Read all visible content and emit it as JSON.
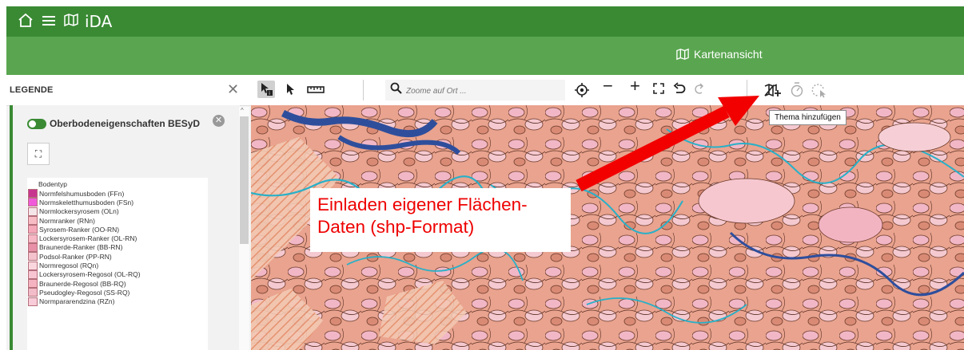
{
  "topbar": {
    "home_icon": "home-icon",
    "menu_icon": "menu-icon",
    "map_icon": "map-icon",
    "app_name": "iDA"
  },
  "subbar": {
    "view_label": "Kartenansicht"
  },
  "sidebar": {
    "title": "LEGENDE",
    "close": "✕",
    "layer_name": "Oberbodeneigenschaften BESyD",
    "legend_caption": "Bodentyp",
    "legend_items": [
      {
        "label": "Normfelshumusboden (FFn)",
        "color": "#c8358f"
      },
      {
        "label": "Normskeletthumusboden (FSn)",
        "color": "#f05ad8"
      },
      {
        "label": "Normlockersyrosem (OLn)",
        "color": "#f4e6e8"
      },
      {
        "label": "Normranker (RNn)",
        "color": "#f7bcc4"
      },
      {
        "label": "Syrosem-Ranker (OO-RN)",
        "color": "#f5a8b8"
      },
      {
        "label": "Lockersyrosem-Ranker (OL-RN)",
        "color": "#f7b8c6"
      },
      {
        "label": "Braunerde-Ranker (BB-RN)",
        "color": "#e890a8"
      },
      {
        "label": "Podsol-Ranker (PP-RN)",
        "color": "#f4c2cc"
      },
      {
        "label": "Normregosol (RQn)",
        "color": "#fad7de"
      },
      {
        "label": "Lockersyrosem-Regosol (OL-RQ)",
        "color": "#f7c4d2"
      },
      {
        "label": "Braunerde-Regosol (BB-RQ)",
        "color": "#f5b3c1"
      },
      {
        "label": "Pseudogley-Regosol (SS-RQ)",
        "color": "#f2bcc8"
      },
      {
        "label": "Normpararendzina (RZn)",
        "color": "#f8ccd8"
      }
    ]
  },
  "toolbar": {
    "search_placeholder": "Zoome auf Ort ...",
    "minus": "−",
    "plus": "+",
    "tooltip": "Thema hinzufügen"
  },
  "annotation": {
    "line1": "Einladen eigener Flächen-",
    "line2": "Daten (shp-Format)"
  }
}
